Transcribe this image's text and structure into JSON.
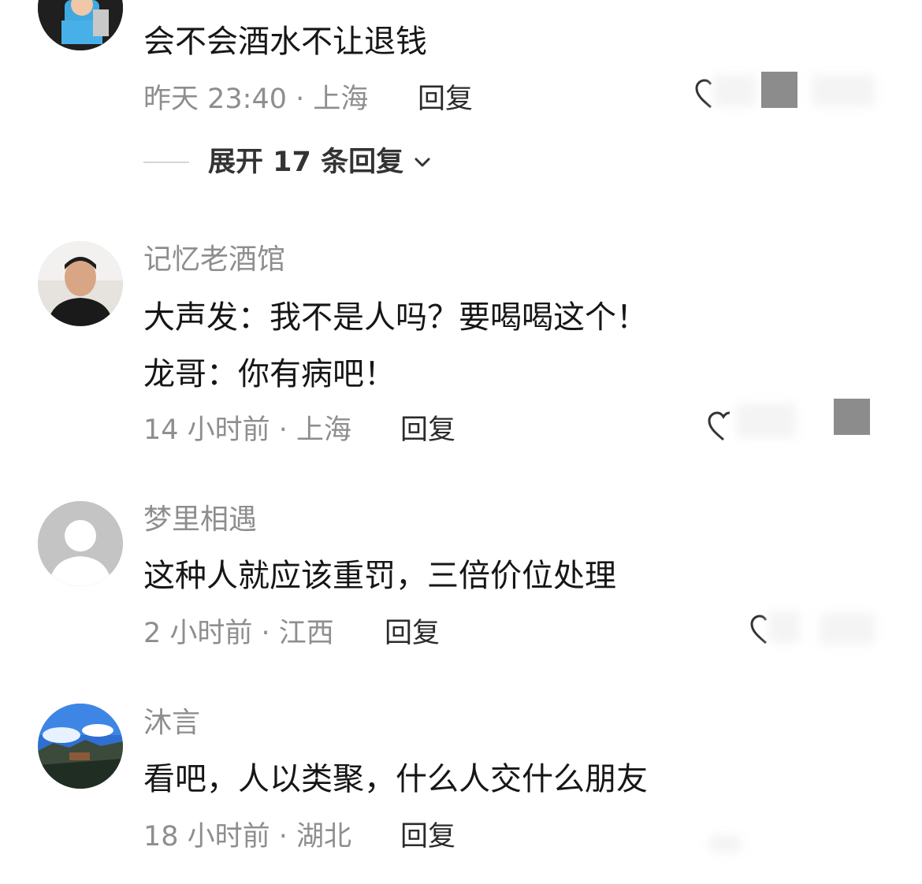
{
  "comments": [
    {
      "content": [
        "会不会酒水不让退钱"
      ],
      "meta": "昨天 23:40 · 上海",
      "reply_label": "回复",
      "expand_label": "展开 17 条回复"
    },
    {
      "username": "记忆老酒馆",
      "content": [
        "大声发：我不是人吗？要喝喝这个！",
        "龙哥：你有病吧！"
      ],
      "meta": "14 小时前 · 上海",
      "reply_label": "回复"
    },
    {
      "username": "梦里相遇",
      "content": [
        "这种人就应该重罚，三倍价位处理"
      ],
      "meta": "2 小时前 · 江西",
      "reply_label": "回复"
    },
    {
      "username": "沐言",
      "content": [
        "看吧，人以类聚，什么人交什么朋友"
      ],
      "meta": "18 小时前 · 湖北",
      "reply_label": "回复"
    }
  ],
  "icons": {
    "like": "heart-outline-icon",
    "expand": "chevron-down-icon",
    "default_avatar": "user-placeholder-icon"
  },
  "colors": {
    "secondary_text": "#8e8e8e",
    "primary_text": "#161616",
    "redaction": "#8c8c8c"
  }
}
